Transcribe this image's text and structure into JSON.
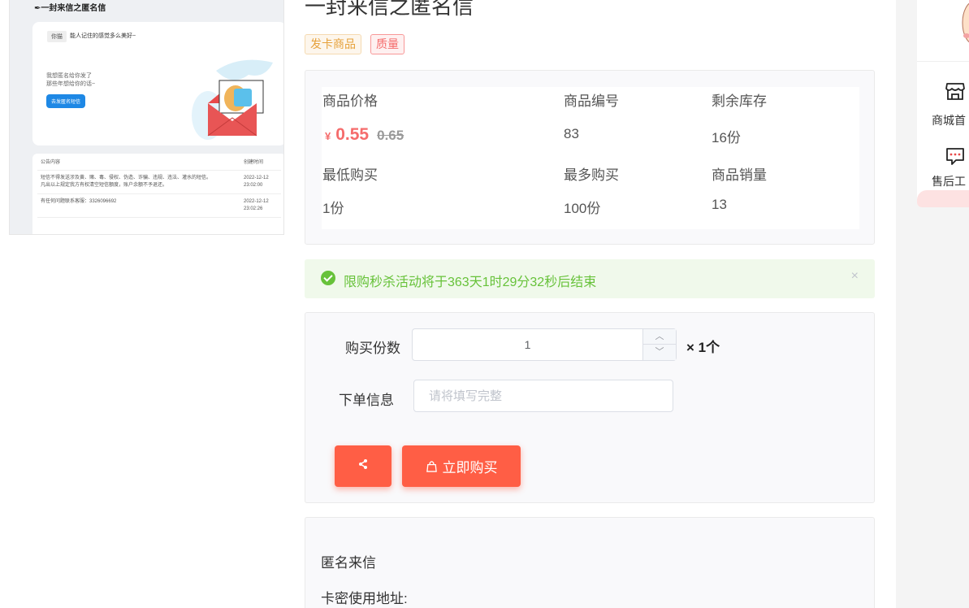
{
  "preview": {
    "title": "一封来信之匿名信",
    "tag": "你猫",
    "message": "能人记住的感觉多么美好~",
    "text_line1": "我想匿名给你发了",
    "text_line2": "那些年想给你的话~",
    "send_button": "去发匿名短信",
    "table_headers": [
      "公告内容",
      "创建时间"
    ],
    "rows": [
      {
        "content_line1": "短信不得发送涉及黄、赌、毒、侵权、伪造、诈骗、违规、违法、灌水的短信。",
        "content_line2": "凡出以上规定我方有权清空短信额度，账户余额不予退还。",
        "date": "2022-12-12",
        "time": "23:02:00"
      },
      {
        "content_line1": "有任何问题联系客服：3326096692",
        "content_line2": "",
        "date": "2022-12-12",
        "time": "23:02:26"
      }
    ]
  },
  "product": {
    "title": "一封来信之匿名信",
    "tags": [
      "发卡商品",
      "质量"
    ]
  },
  "info": {
    "price_label": "商品价格",
    "currency": "¥",
    "price": "0.55",
    "old_price": "0.65",
    "code_label": "商品编号",
    "code": "83",
    "stock_label": "剩余库存",
    "stock": "16份",
    "min_label": "最低购买",
    "min": "1份",
    "max_label": "最多购买",
    "max": "100份",
    "sales_label": "商品销量",
    "sales": "13"
  },
  "alert": {
    "text": "限购秒杀活动将于363天1时29分32秒后结束",
    "close": "×"
  },
  "order": {
    "qty_label": "购买份数",
    "qty_value": "1",
    "step_up": "︿",
    "step_down": "﹀",
    "unit": "× 1个",
    "info_label": "下单信息",
    "info_placeholder": "请将填写完整",
    "share_icon": "share-icon",
    "buy_label": "立即购买"
  },
  "description": {
    "line1": "匿名来信",
    "line2": "卡密使用地址:"
  },
  "sidebar": {
    "home_label": "商城首",
    "service_label": "售后工"
  },
  "colors": {
    "accent": "#ff5e45",
    "price": "#f56c6c",
    "success": "#67c23a",
    "tag_orange": "#e6a23c"
  }
}
